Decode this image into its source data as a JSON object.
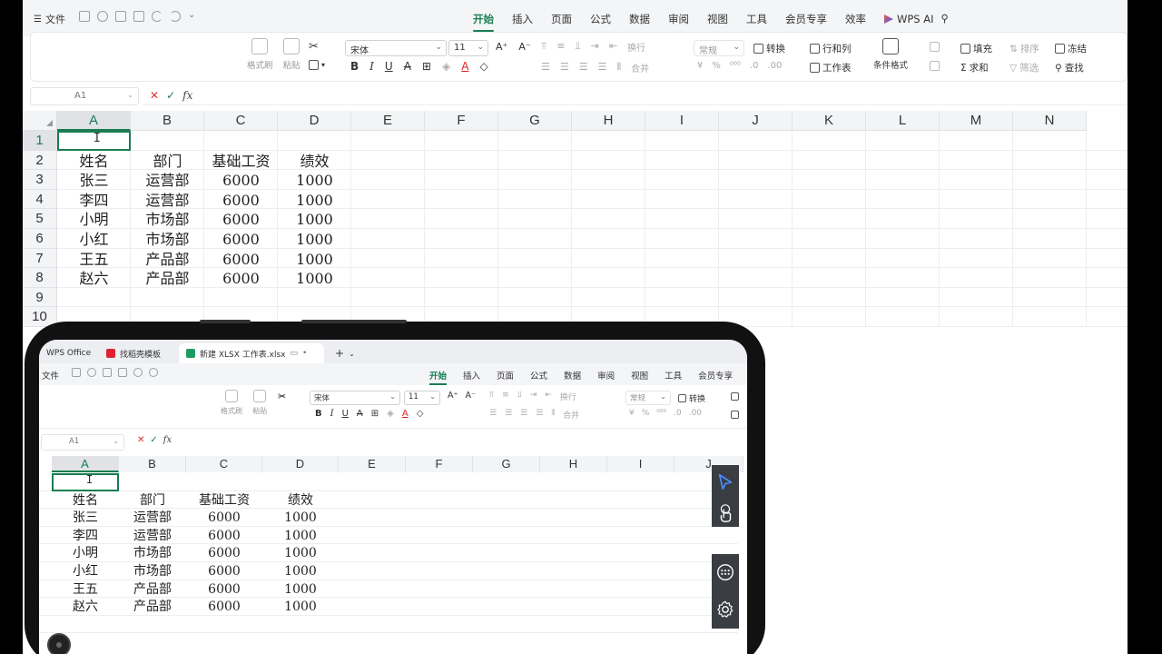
{
  "menubar": {
    "file_label": "文件",
    "tabs": [
      "开始",
      "插入",
      "页面",
      "公式",
      "数据",
      "审阅",
      "视图",
      "工具",
      "会员专享",
      "效率"
    ],
    "wps_ai": "WPS AI"
  },
  "ribbon": {
    "format_painter": "格式刷",
    "paste": "粘贴",
    "font_name": "宋体",
    "font_size": "11",
    "wrap": "换行",
    "merge": "合并",
    "number_format": "常规",
    "convert": "转换",
    "rows_cols": "行和列",
    "worksheet": "工作表",
    "cond_format": "条件格式",
    "fill": "填充",
    "sort": "排序",
    "freeze": "冻结",
    "sum": "求和",
    "filter": "筛选",
    "find": "查找"
  },
  "formula_bar": {
    "name_box": "A1",
    "fx": "fx"
  },
  "columns": [
    "A",
    "B",
    "C",
    "D",
    "E",
    "F",
    "G",
    "H",
    "I",
    "J",
    "K",
    "L",
    "M",
    "N"
  ],
  "rows": [
    "1",
    "2",
    "3",
    "4",
    "5",
    "6",
    "7",
    "8",
    "9",
    "10"
  ],
  "table": {
    "headers": [
      "姓名",
      "部门",
      "基础工资",
      "绩效"
    ],
    "rows": [
      [
        "张三",
        "运营部",
        "6000",
        "1000"
      ],
      [
        "李四",
        "运营部",
        "6000",
        "1000"
      ],
      [
        "小明",
        "市场部",
        "6000",
        "1000"
      ],
      [
        "小红",
        "市场部",
        "6000",
        "1000"
      ],
      [
        "王五",
        "产品部",
        "6000",
        "1000"
      ],
      [
        "赵六",
        "产品部",
        "6000",
        "1000"
      ]
    ]
  },
  "phone": {
    "tabs": [
      "WPS Office",
      "找稻壳模板",
      "新建 XLSX 工作表.xlsx"
    ],
    "file_label": "文件",
    "menu_tabs": [
      "开始",
      "插入",
      "页面",
      "公式",
      "数据",
      "审阅",
      "视图",
      "工具",
      "会员专享"
    ],
    "font_name": "宋体",
    "font_size": "11",
    "number_format": "常规",
    "convert": "转换",
    "format_painter": "格式刷",
    "paste": "粘贴",
    "wrap": "换行",
    "merge": "合并",
    "name_box": "A1",
    "fx": "fx",
    "columns": [
      "A",
      "B",
      "C",
      "D",
      "E",
      "F",
      "G",
      "H",
      "I",
      "J"
    ]
  },
  "colors": {
    "accent": "#1a7d52",
    "header_bg": "#f3f4f6",
    "side_panel": "#3a3d42"
  }
}
